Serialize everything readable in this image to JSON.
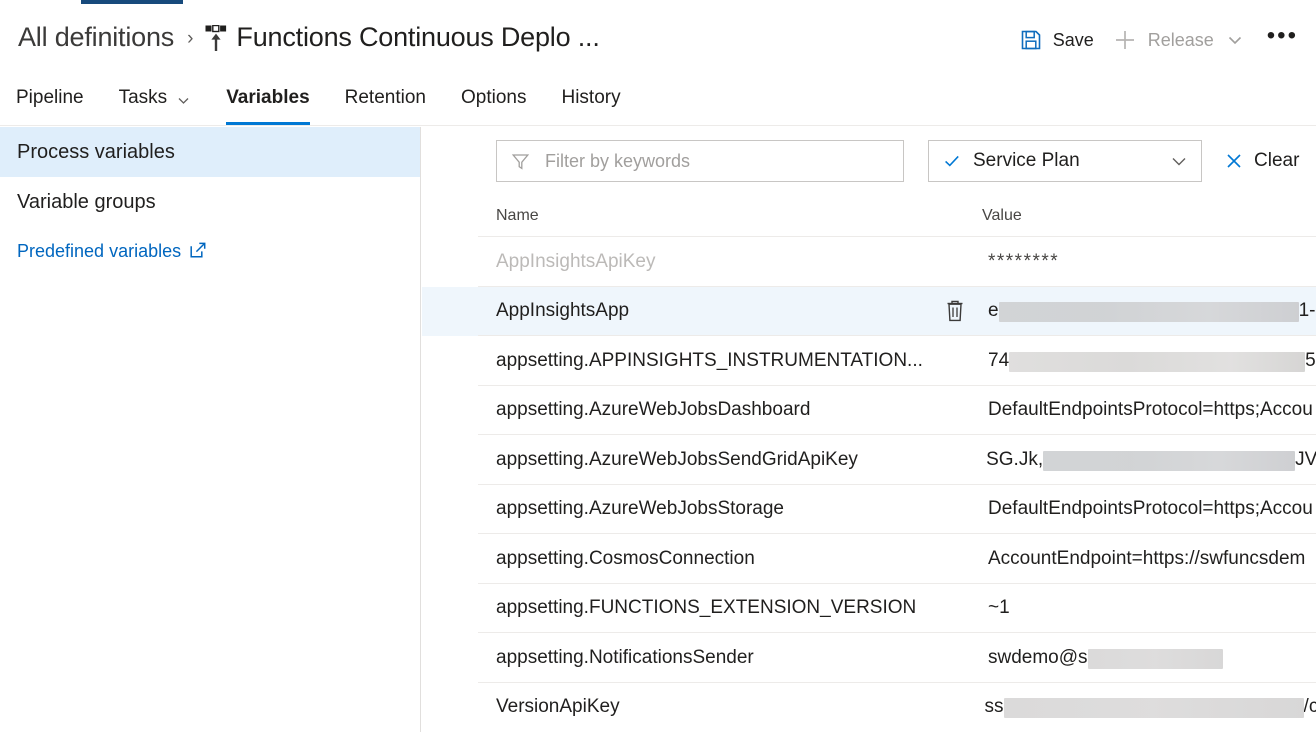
{
  "header": {
    "breadcrumb_root": "All definitions",
    "breadcrumb_separator": "›",
    "pipeline_icon": "release-pipeline-icon",
    "title": "Functions Continuous Deplo ..."
  },
  "toolbar": {
    "save_label": "Save",
    "save_icon": "save-floppy-icon",
    "release_label": "Release",
    "release_icon": "plus-icon",
    "release_chevron_icon": "chevron-down-icon",
    "release_disabled": true,
    "more_label": "•••",
    "more_icon": "ellipsis-icon"
  },
  "tabs": [
    {
      "label": "Pipeline",
      "active": false,
      "has_chevron": false
    },
    {
      "label": "Tasks",
      "active": false,
      "has_chevron": true
    },
    {
      "label": "Variables",
      "active": true,
      "has_chevron": false
    },
    {
      "label": "Retention",
      "active": false,
      "has_chevron": false
    },
    {
      "label": "Options",
      "active": false,
      "has_chevron": false
    },
    {
      "label": "History",
      "active": false,
      "has_chevron": false
    }
  ],
  "sidebar": {
    "items": [
      {
        "label": "Process variables",
        "selected": true
      },
      {
        "label": "Variable groups",
        "selected": false
      }
    ],
    "link": {
      "label": "Predefined variables",
      "icon": "external-link-icon"
    }
  },
  "filter": {
    "placeholder": "Filter by keywords",
    "value": "",
    "funnel_icon": "filter-funnel-icon",
    "scope_dropdown": {
      "label": "Service Plan",
      "check_icon": "checkmark-icon",
      "chevron_icon": "chevron-down-icon"
    },
    "clear": {
      "label": "Clear",
      "icon": "close-x-icon"
    }
  },
  "table": {
    "columns": {
      "name": "Name",
      "value": "Value"
    },
    "delete_icon": "trash-icon",
    "rows": [
      {
        "name": "AppInsightsApiKey",
        "value_prefix": "********",
        "redacted": false,
        "disabled": true,
        "highlight": false,
        "show_delete": false
      },
      {
        "name": "AppInsightsApp",
        "value_prefix": "e",
        "value_suffix": "1-",
        "redacted": true,
        "redact_width": 300,
        "disabled": false,
        "highlight": true,
        "show_delete": true
      },
      {
        "name": "appsetting.APPINSIGHTS_INSTRUMENTATION...",
        "value_prefix": "74",
        "value_suffix": "5",
        "redacted": true,
        "redact_width": 296,
        "disabled": false,
        "highlight": false,
        "show_delete": false
      },
      {
        "name": "appsetting.AzureWebJobsDashboard",
        "value_prefix": "DefaultEndpointsProtocol=https;Accou",
        "redacted": false,
        "disabled": false,
        "highlight": false,
        "show_delete": false
      },
      {
        "name": "appsetting.AzureWebJobsSendGridApiKey",
        "value_prefix": "SG.Jk,",
        "value_suffix": "JV",
        "redacted": true,
        "redact_width": 252,
        "disabled": false,
        "highlight": false,
        "show_delete": false
      },
      {
        "name": "appsetting.AzureWebJobsStorage",
        "value_prefix": "DefaultEndpointsProtocol=https;Accou",
        "redacted": false,
        "disabled": false,
        "highlight": false,
        "show_delete": false
      },
      {
        "name": "appsetting.CosmosConnection",
        "value_prefix": "AccountEndpoint=https://swfuncsdem",
        "redacted": false,
        "disabled": false,
        "highlight": false,
        "show_delete": false
      },
      {
        "name": "appsetting.FUNCTIONS_EXTENSION_VERSION",
        "value_prefix": "~1",
        "redacted": false,
        "disabled": false,
        "highlight": false,
        "show_delete": false
      },
      {
        "name": "appsetting.NotificationsSender",
        "value_prefix": "swdemo@s",
        "value_suffix": "",
        "redacted": true,
        "redact_width": 135,
        "disabled": false,
        "highlight": false,
        "show_delete": false
      },
      {
        "name": "VersionApiKey",
        "value_prefix": "ss",
        "value_suffix": "/c",
        "redacted": true,
        "redact_width": 300,
        "disabled": false,
        "highlight": false,
        "show_delete": false
      }
    ]
  },
  "colors": {
    "accent": "#0078d4",
    "link": "#0066bf",
    "selected_bg": "#dfeefb",
    "row_highlight_bg": "#eff6fc",
    "top_indicator": "#174a7c",
    "text": "#201f1e",
    "muted_text": "#a19f9d",
    "border": "#c8c6c4"
  }
}
